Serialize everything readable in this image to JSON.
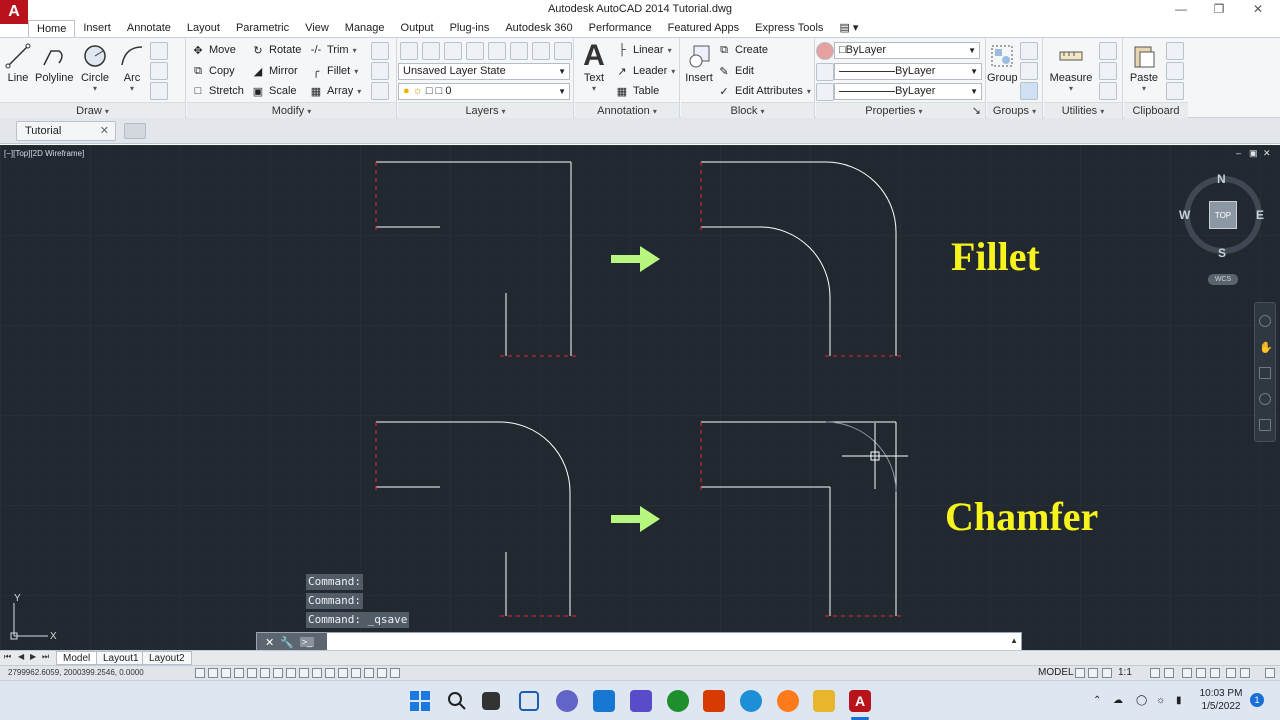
{
  "app": {
    "logo_glyph": "A",
    "title": "Autodesk AutoCAD 2014    Tutorial.dwg",
    "window_controls": [
      "—",
      "❐",
      "✕"
    ]
  },
  "menu": {
    "tabs": [
      "Home",
      "Insert",
      "Annotate",
      "Layout",
      "Parametric",
      "View",
      "Manage",
      "Output",
      "Plug-ins",
      "Autodesk 360",
      "Performance",
      "Featured Apps",
      "Express Tools"
    ],
    "active": "Home"
  },
  "ribbon": {
    "draw": {
      "title": "Draw",
      "line": "Line",
      "polyline": "Polyline",
      "circle": "Circle",
      "arc": "Arc"
    },
    "modify": {
      "title": "Modify",
      "move": "Move",
      "rotate": "Rotate",
      "trim": "Trim",
      "copy": "Copy",
      "mirror": "Mirror",
      "fillet": "Fillet",
      "stretch": "Stretch",
      "scale": "Scale",
      "array": "Array"
    },
    "layers": {
      "title": "Layers",
      "layer_state": "Unsaved Layer State",
      "current_layer": "0"
    },
    "annotation": {
      "title": "Annotation",
      "text": "Text",
      "linear": "Linear",
      "leader": "Leader",
      "table": "Table"
    },
    "block": {
      "title": "Block",
      "insert": "Insert",
      "create": "Create",
      "edit": "Edit",
      "edit_attributes": "Edit Attributes"
    },
    "properties": {
      "title": "Properties",
      "color": "ByLayer",
      "linetype": "ByLayer",
      "lineweight": "ByLayer"
    },
    "groups": {
      "title": "Groups",
      "group": "Group"
    },
    "utilities": {
      "title": "Utilities",
      "measure": "Measure"
    },
    "clipboard": {
      "title": "Clipboard",
      "paste": "Paste"
    }
  },
  "file_tab": {
    "name": "Tutorial",
    "close": "✕"
  },
  "viewport": {
    "label": "[−][Top][2D Wireframe]",
    "controls": [
      "–",
      "▣",
      "✕"
    ],
    "viewcube": {
      "top": "TOP",
      "north": "N",
      "south": "S",
      "east": "E",
      "west": "W"
    },
    "wcs": "WCS"
  },
  "drawing": {
    "labels": {
      "fillet": "Fillet",
      "chamfer": "Chamfer"
    },
    "colors": {
      "background": "#212830",
      "lines": "#ffffff",
      "hidden": "#e3282b",
      "arrow": "#b8f77e",
      "label": "#f7f31d"
    }
  },
  "command": {
    "history": [
      "Command:",
      "Command:",
      "Command:  _qsave"
    ],
    "input_value": "",
    "prompt_icon": ">_"
  },
  "layout_tabs": {
    "model": "Model",
    "layout1": "Layout1",
    "layout2": "Layout2"
  },
  "status": {
    "coordinates": "2799962.6059, 2000399.2546, 0.0000",
    "model": "MODEL",
    "scale": "1:1"
  },
  "taskbar": {
    "time": "10:03 PM",
    "date": "1/5/2022",
    "notifications": "1"
  }
}
